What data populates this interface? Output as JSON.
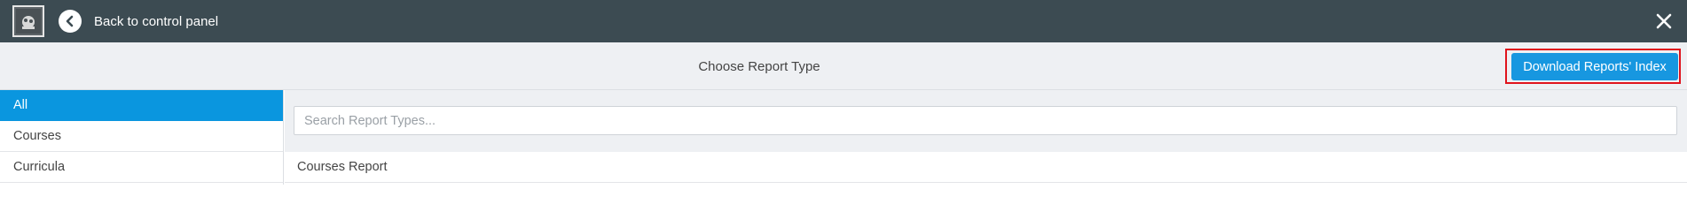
{
  "topbar": {
    "logo_icon": "app-logo-icon",
    "back_label": "Back to control panel",
    "back_icon": "chevron-left-icon",
    "close_icon": "close-icon",
    "background": "#3c4b52"
  },
  "header": {
    "title": "Choose Report Type",
    "download_button_label": "Download Reports' Index",
    "accent": "#1797e0",
    "highlight": "#e0131c"
  },
  "sidebar": {
    "items": [
      {
        "label": "All",
        "active": true
      },
      {
        "label": "Courses",
        "active": false
      },
      {
        "label": "Curricula",
        "active": false
      }
    ]
  },
  "search": {
    "placeholder": "Search Report Types...",
    "value": ""
  },
  "results": [
    {
      "label": "Courses Report"
    }
  ]
}
